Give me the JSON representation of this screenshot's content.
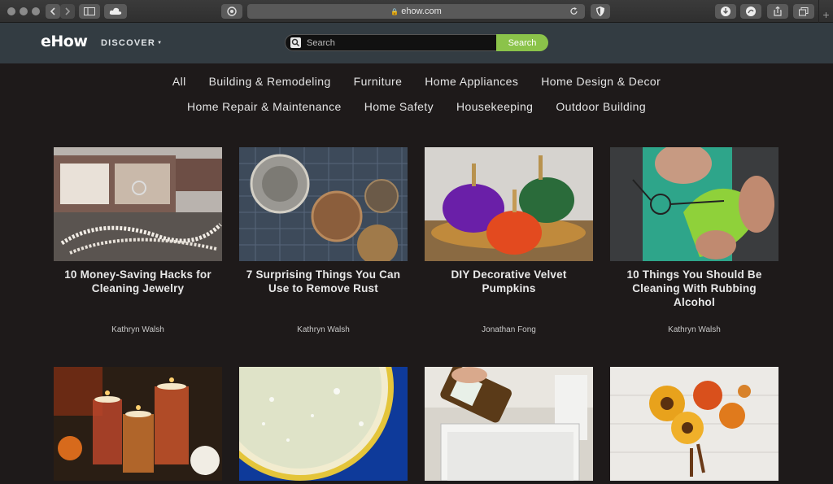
{
  "browser": {
    "url": "ehow.com"
  },
  "header": {
    "logo": "eHow",
    "discover_label": "DISCOVER",
    "search_placeholder": "Search",
    "search_button": "Search"
  },
  "categories": {
    "row1": [
      "All",
      "Building & Remodeling",
      "Furniture",
      "Home Appliances",
      "Home Design & Decor"
    ],
    "row2": [
      "Home Repair & Maintenance",
      "Home Safety",
      "Housekeeping",
      "Outdoor Building"
    ]
  },
  "articles": [
    {
      "title": "10 Money-Saving Hacks for Cleaning Jewelry",
      "author": "Kathryn Walsh"
    },
    {
      "title": "7 Surprising Things You Can Use to Remove Rust",
      "author": "Kathryn Walsh"
    },
    {
      "title": "DIY Decorative Velvet Pumpkins",
      "author": "Jonathan Fong"
    },
    {
      "title": "10 Things You Should Be Cleaning With Rubbing Alcohol",
      "author": "Kathryn Walsh"
    }
  ],
  "colors": {
    "header_bg": "#333c42",
    "page_bg": "#1e1a1a",
    "search_button": "#8bc34a"
  }
}
